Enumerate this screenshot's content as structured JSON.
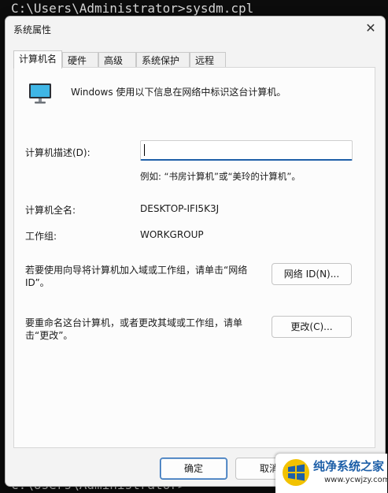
{
  "console": {
    "top_line": "C:\\Users\\Administrator>sysdm.cpl",
    "bottom_line": "C:\\Users\\Administrator>"
  },
  "dialog": {
    "title": "系统属性",
    "close_glyph": "✕",
    "tabs": [
      "计算机名",
      "硬件",
      "高级",
      "系统保护",
      "远程"
    ],
    "active_tab": "计算机名",
    "intro": "Windows 使用以下信息在网络中标识这台计算机。",
    "description_label": "计算机描述(D):",
    "description_value": "",
    "example": "例如: “书房计算机”或“美玲的计算机”。",
    "fullname_label": "计算机全名:",
    "fullname_value": "DESKTOP-IFI5K3J",
    "workgroup_label": "工作组:",
    "workgroup_value": "WORKGROUP",
    "network_text": "若要使用向导将计算机加入域或工作组，请单击“网络 ID”。",
    "network_button": "网络 ID(N)...",
    "rename_text": "要重命名这台计算机，或者更改其域或工作组，请单击“更改”。",
    "change_button": "更改(C)...",
    "ok_button": "确定",
    "cancel_button": "取消"
  },
  "watermark": {
    "title": "纯净系统之家",
    "url": "www.ycwjzy.com"
  },
  "colors": {
    "accent": "#1f5fa8",
    "console_bg": "#0c0c0c",
    "dialog_bg": "#f3f3f3"
  }
}
